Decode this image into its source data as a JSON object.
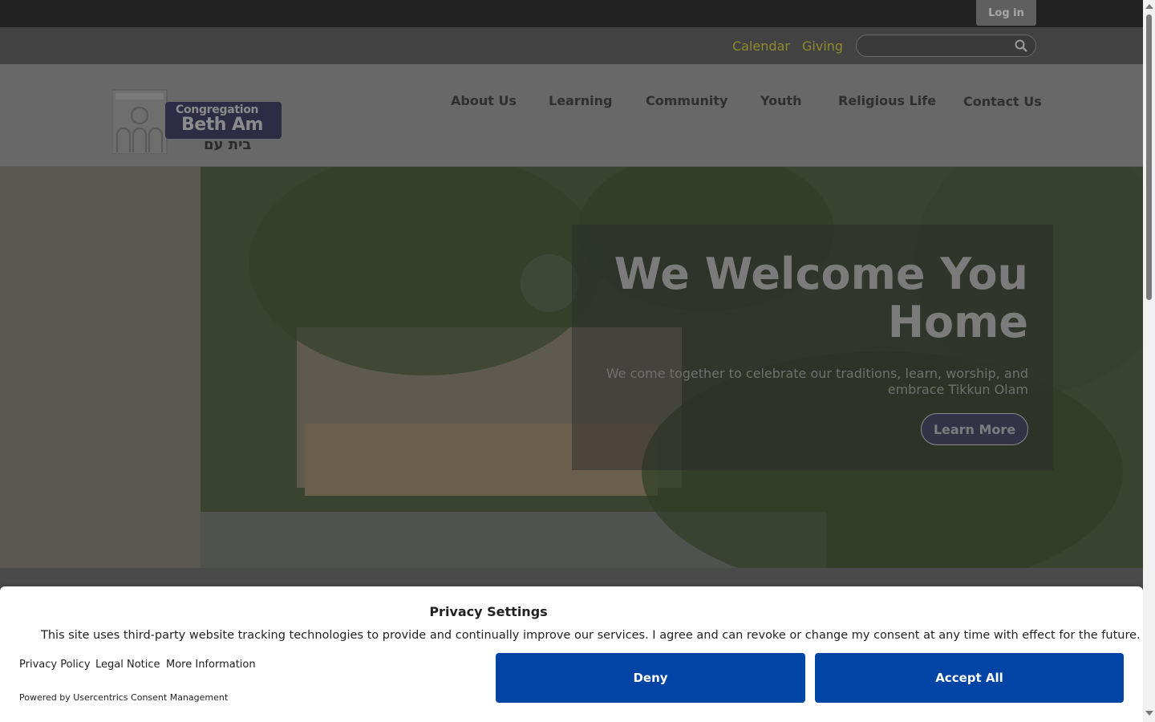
{
  "topbar": {
    "login_label": "Log in"
  },
  "utility": {
    "calendar": "Calendar",
    "giving": "Giving",
    "search_placeholder": ""
  },
  "logo": {
    "line1": "Congregation",
    "line2": "Beth Am",
    "hebrew": "בית עם"
  },
  "nav": {
    "items": [
      {
        "label": "About Us"
      },
      {
        "label": "Learning"
      },
      {
        "label": "Community"
      },
      {
        "label": "Youth"
      },
      {
        "label": "Religious Life"
      },
      {
        "label": "Contact Us"
      }
    ]
  },
  "hero": {
    "title": "We Welcome You Home",
    "subtitle": "We come together to celebrate our traditions, learn, worship, and embrace Tikkun Olam",
    "button": "Learn More"
  },
  "consent": {
    "title": "Privacy Settings",
    "text": "This site uses third-party website tracking technologies to provide and continually improve our services. I agree and can revoke or change my consent at any time with effect for the future.",
    "links": [
      "Privacy Policy",
      "Legal Notice",
      "More Information"
    ],
    "powered": "Powered by Usercentrics Consent Management",
    "deny": "Deny",
    "accept": "Accept All"
  },
  "colors": {
    "accent_link": "#8d8a2c",
    "consent_button": "#0045a5"
  }
}
